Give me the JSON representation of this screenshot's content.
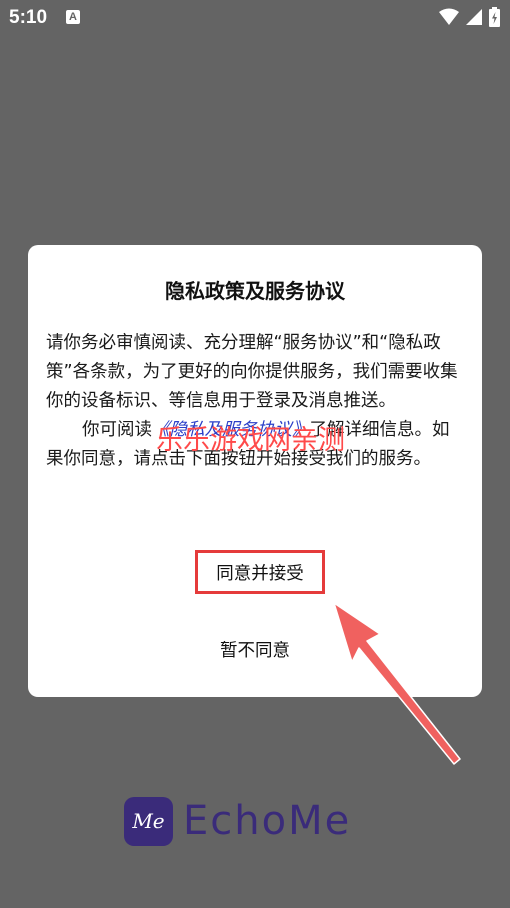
{
  "status_bar": {
    "time": "5:10",
    "notification_badge": "A",
    "icons": [
      "wifi-icon",
      "signal-icon",
      "battery-charging-icon"
    ]
  },
  "dialog": {
    "title": "隐私政策及服务协议",
    "body_line1": "请你务必审慎阅读、充分理解“服务协议”和“隐私政策”各条款，为了更好的向你提供服务，我们需要收集你的设备标识、等信息用于登录及消息推送。",
    "body_p2_prefix": "你可阅读",
    "body_p2_link": "《隐私及服务协议》",
    "body_p2_suffix": "了解详细信息。如果你同意，请点击下面按钮开始接受我们的服务。",
    "agree_label": "同意并接受",
    "disagree_label": "暂不同意"
  },
  "watermark": "乐乐游戏网亲测",
  "logo": {
    "badge_text": "Me",
    "name": "EchoMe"
  },
  "colors": {
    "backdrop": "#646464",
    "highlight_red": "#e53b3b",
    "link_blue": "#2a3fc8",
    "brand_purple": "#3a2b7a"
  }
}
